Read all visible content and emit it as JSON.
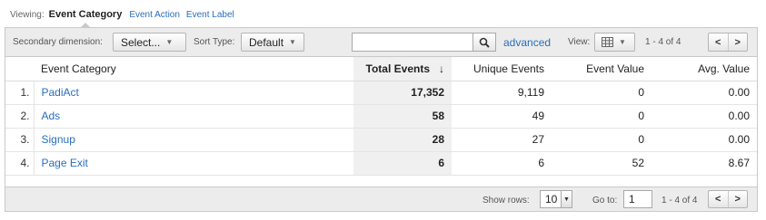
{
  "viewing": {
    "label": "Viewing:",
    "active": "Event Category",
    "links": [
      "Event Action",
      "Event Label"
    ]
  },
  "toolbar": {
    "secondary_label": "Secondary dimension:",
    "secondary_value": "Select...",
    "sort_label": "Sort Type:",
    "sort_value": "Default",
    "search_value": "",
    "advanced": "advanced",
    "view_label": "View:",
    "range": "1 - 4 of 4"
  },
  "table": {
    "columns": [
      "Event Category",
      "Total Events",
      "Unique Events",
      "Event Value",
      "Avg. Value"
    ],
    "rows": [
      {
        "index": "1.",
        "category": "PadiAct",
        "total": "17,352",
        "unique": "9,119",
        "value": "0",
        "avg": "0.00"
      },
      {
        "index": "2.",
        "category": "Ads",
        "total": "58",
        "unique": "49",
        "value": "0",
        "avg": "0.00"
      },
      {
        "index": "3.",
        "category": "Signup",
        "total": "28",
        "unique": "27",
        "value": "0",
        "avg": "0.00"
      },
      {
        "index": "4.",
        "category": "Page Exit",
        "total": "6",
        "unique": "6",
        "value": "52",
        "avg": "8.67"
      }
    ]
  },
  "footer": {
    "show_rows_label": "Show rows:",
    "show_rows_value": "10",
    "goto_label": "Go to:",
    "goto_value": "1",
    "range": "1 - 4 of 4"
  },
  "colors": {
    "link": "#2a6ebb",
    "toolbar_bg": "#ececec",
    "sorted_col_bg": "#f0f0f0"
  },
  "icons": {
    "search": "search-icon",
    "view": "grid-view-icon",
    "prev": "chevron-left-icon",
    "next": "chevron-right-icon",
    "sort": "sort-down-arrow-icon"
  }
}
